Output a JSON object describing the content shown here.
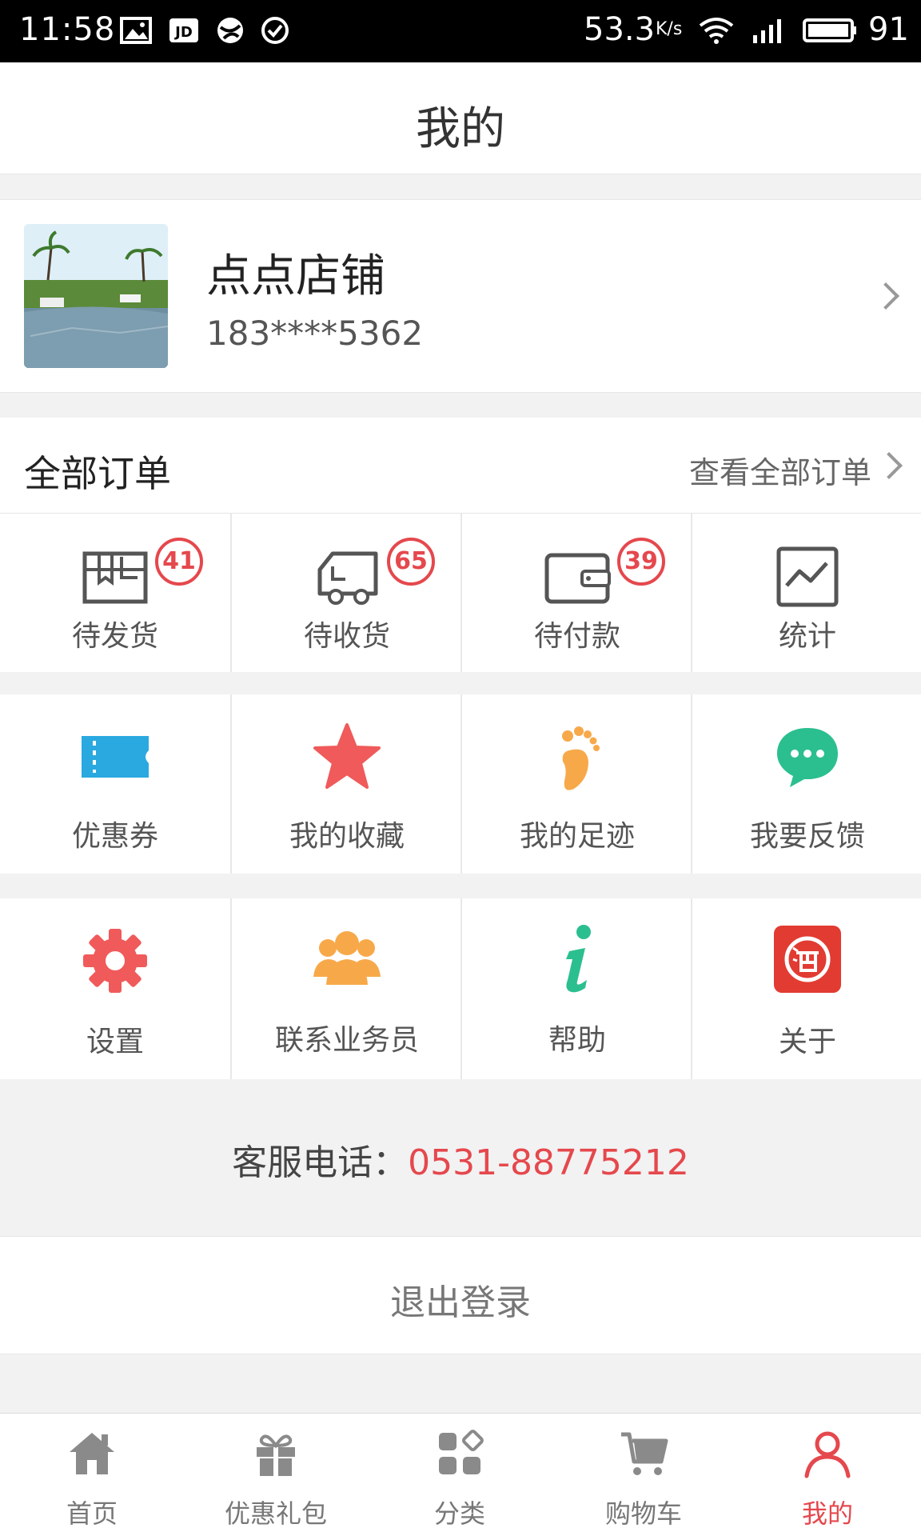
{
  "status_bar": {
    "time": "11:58",
    "net_speed": "53.3",
    "net_unit": "K/s",
    "battery": "91",
    "icons": [
      "image-icon",
      "jd-icon",
      "app-icon",
      "check-circle-icon",
      "wifi-icon",
      "signal-3g-icon",
      "battery-icon"
    ]
  },
  "header": {
    "title": "我的"
  },
  "profile": {
    "shop_name": "点点店铺",
    "phone": "183****5362"
  },
  "orders": {
    "title": "全部订单",
    "view_all": "查看全部订单",
    "items": [
      {
        "label": "待发货",
        "badge": "41",
        "icon": "package-icon"
      },
      {
        "label": "待收货",
        "badge": "65",
        "icon": "truck-icon"
      },
      {
        "label": "待付款",
        "badge": "39",
        "icon": "wallet-icon"
      },
      {
        "label": "统计",
        "icon": "chart-icon"
      }
    ]
  },
  "menu_row1": [
    {
      "label": "优惠券",
      "icon": "coupon-icon",
      "color": "#2aa9e0"
    },
    {
      "label": "我的收藏",
      "icon": "star-icon",
      "color": "#f05a5a"
    },
    {
      "label": "我的足迹",
      "icon": "footprint-icon",
      "color": "#f7a94a"
    },
    {
      "label": "我要反馈",
      "icon": "chat-bubble-icon",
      "color": "#2bbf8f"
    }
  ],
  "menu_row2": [
    {
      "label": "设置",
      "icon": "gear-icon",
      "color": "#f05a5a"
    },
    {
      "label": "联系业务员",
      "icon": "people-icon",
      "color": "#f7a94a"
    },
    {
      "label": "帮助",
      "icon": "info-icon",
      "color": "#2bbf8f"
    },
    {
      "label": "关于",
      "icon": "wine-logo-icon",
      "color": "#e23b32"
    }
  ],
  "service": {
    "label": "客服电话：",
    "number": "0531-88775212"
  },
  "logout": {
    "label": "退出登录"
  },
  "tabbar": {
    "active_color": "#e5484d",
    "items": [
      {
        "label": "首页",
        "icon": "home-icon"
      },
      {
        "label": "优惠礼包",
        "icon": "gift-icon"
      },
      {
        "label": "分类",
        "icon": "category-icon"
      },
      {
        "label": "购物车",
        "icon": "cart-icon"
      },
      {
        "label": "我的",
        "icon": "user-icon",
        "active": true
      }
    ]
  }
}
